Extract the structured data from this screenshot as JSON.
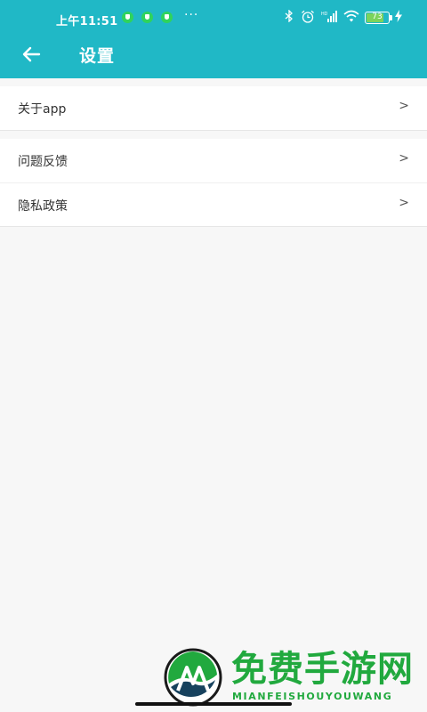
{
  "status_bar": {
    "time": "上午11:51",
    "dots": "···",
    "battery_level": "73",
    "icons": [
      "notification-shield-icon",
      "notification-shield-icon",
      "notification-shield-icon",
      "bluetooth-icon",
      "alarm-icon",
      "signal-icon",
      "wifi-icon",
      "battery-icon",
      "charging-icon"
    ]
  },
  "header": {
    "title": "设置",
    "back_icon": "arrow-left-icon"
  },
  "settings": {
    "group1": [
      {
        "label": "关于app",
        "arrow": ">"
      }
    ],
    "group2": [
      {
        "label": "问题反馈",
        "arrow": ">"
      },
      {
        "label": "隐私政策",
        "arrow": ">"
      }
    ]
  },
  "watermark": {
    "title": "免费手游网",
    "subtitle": "MIANFEISHOUYOUWANG"
  },
  "colors": {
    "accent": "#20b8c6",
    "background": "#f7f7f7",
    "watermark": "#21a93e"
  }
}
